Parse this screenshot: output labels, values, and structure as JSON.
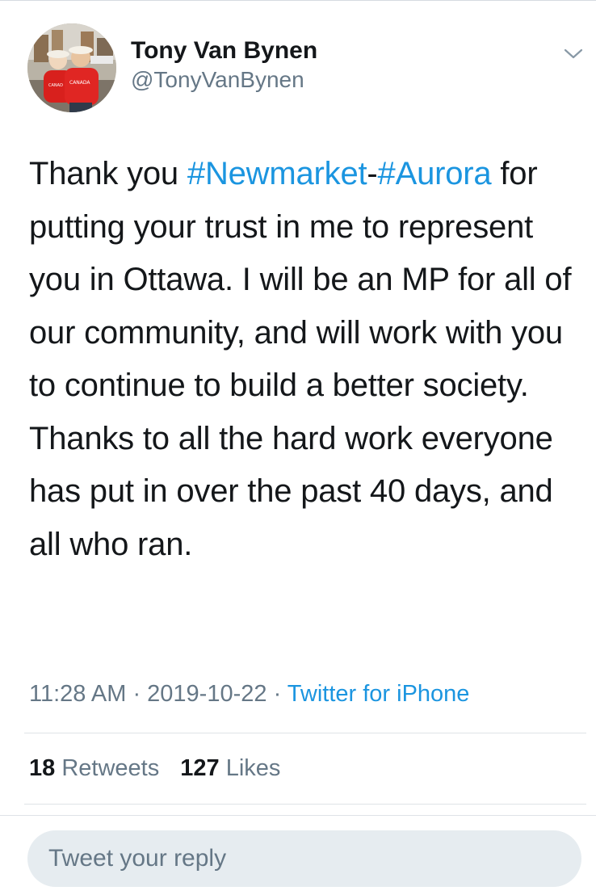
{
  "tweet": {
    "author": {
      "display_name": "Tony Van Bynen",
      "handle": "@TonyVanBynen",
      "avatar_icon": "profile-photo"
    },
    "menu_icon": "chevron-down-icon",
    "text": {
      "part1": "Thank you ",
      "hashtag1": "#Newmarket",
      "dash": "-",
      "hashtag2": "#Aurora",
      "part2": " for putting your trust in me to represent you in Ottawa. I will be an MP for all of our community, and will work with you to continue to build a better society. Thanks to all the hard work everyone has put in over the past 40 days, and all who ran."
    },
    "meta": {
      "time": "11:28 AM",
      "separator": " · ",
      "date": "2019-10-22",
      "source": "Twitter for iPhone"
    },
    "stats": {
      "retweets_count": "18",
      "retweets_label": "Retweets",
      "likes_count": "127",
      "likes_label": "Likes"
    }
  },
  "reply": {
    "placeholder": "Tweet your reply"
  },
  "colors": {
    "link": "#1b95e0",
    "secondary_text": "#657786",
    "primary_text": "#14171a",
    "reply_bg": "#e6ecf0"
  }
}
